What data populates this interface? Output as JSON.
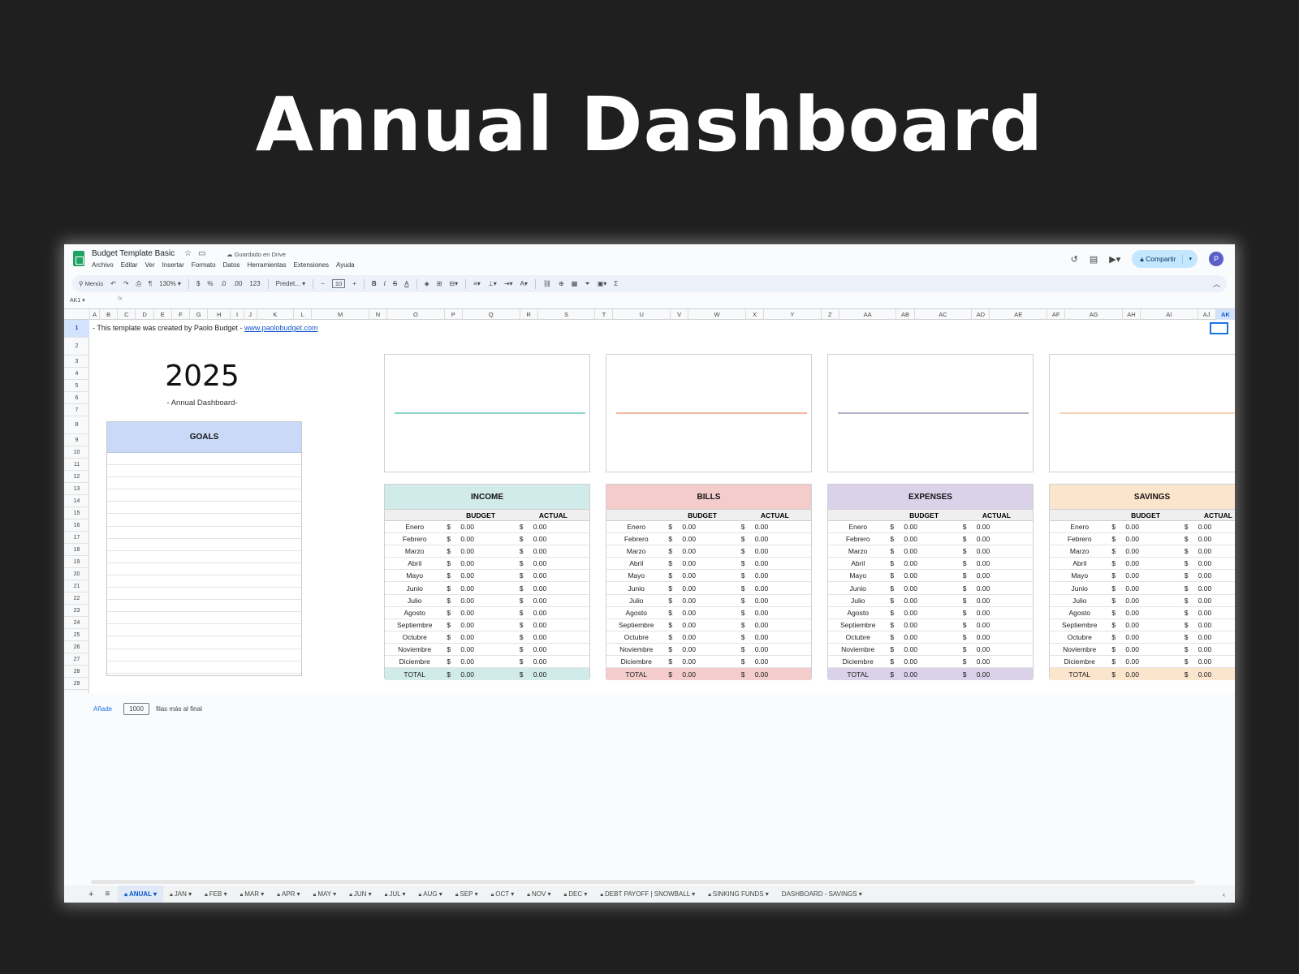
{
  "page_title": "Annual Dashboard",
  "header": {
    "doc_title": "Budget Template Basic",
    "saved_status": "Guardado en Drive",
    "menu": [
      "Archivo",
      "Editar",
      "Ver",
      "Insertar",
      "Formato",
      "Datos",
      "Herramientas",
      "Extensiones",
      "Ayuda"
    ],
    "share_label": "Compartir",
    "avatar_initial": "P"
  },
  "toolbar": {
    "menus_label": "Menús",
    "zoom": "130%",
    "currency": "$",
    "percent": "%",
    "dec_down": ".0",
    "dec_up": ".00",
    "num_format": "123",
    "font": "Predet...",
    "font_size": "10"
  },
  "formula_bar": {
    "cell_ref": "AK1",
    "fx": "fx"
  },
  "columns": [
    "A",
    "B",
    "C",
    "D",
    "E",
    "F",
    "G",
    "H",
    "I",
    "J",
    "K",
    "L",
    "M",
    "N",
    "O",
    "P",
    "Q",
    "R",
    "S",
    "T",
    "U",
    "V",
    "W",
    "X",
    "Y",
    "Z",
    "AA",
    "AB",
    "AC",
    "AD",
    "AE",
    "AF",
    "AG",
    "AH",
    "AI",
    "AJ",
    "AK"
  ],
  "rows": [
    "1",
    "2",
    "3",
    "4",
    "5",
    "6",
    "7",
    "8",
    "9",
    "10",
    "11",
    "12",
    "13",
    "14",
    "15",
    "16",
    "17",
    "18",
    "19",
    "20",
    "21",
    "22",
    "23",
    "24",
    "25",
    "26",
    "27",
    "28",
    "29"
  ],
  "sheet": {
    "credit_text": "- This template was created by Paolo Budget - ",
    "credit_link": "www.paolobudget.com",
    "year": "2025",
    "year_sub": "- Annual Dashboard-",
    "goals_title": "GOALS"
  },
  "table_headers": {
    "budget": "BUDGET",
    "actual": "ACTUAL"
  },
  "months": [
    "Enero",
    "Febrero",
    "Marzo",
    "Abril",
    "Mayo",
    "Junio",
    "Julio",
    "Agosto",
    "Septiembre",
    "Octubre",
    "Noviembre",
    "Diciembre"
  ],
  "total_label": "TOTAL",
  "currency_symbol": "$",
  "zero_value": "0.00",
  "tables": [
    {
      "title": "INCOME",
      "color": "#d0ebe9",
      "line_color": "#8fd4cb"
    },
    {
      "title": "BILLS",
      "color": "#f4cccc",
      "line_color": "#f0b8a0"
    },
    {
      "title": "EXPENSES",
      "color": "#d9d2e9",
      "line_color": "#b8b0c8"
    },
    {
      "title": "SAVINGS",
      "color": "#fce5cd",
      "line_color": "#f6d2b0"
    }
  ],
  "add_rows": {
    "button": "Añade",
    "count": "1000",
    "suffix": "filas más al final"
  },
  "tabs": [
    "ANUAL",
    "JAN",
    "FEB",
    "MAR",
    "APR",
    "MAY",
    "JUN",
    "JUL",
    "AUG",
    "SEP",
    "OCT",
    "NOV",
    "DEC",
    "DEBT PAYOFF | SNOWBALL",
    "SINKING FUNDS",
    "DASHBOARD - SAVINGS"
  ]
}
